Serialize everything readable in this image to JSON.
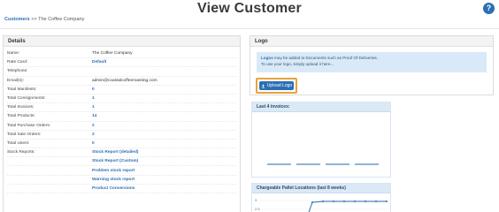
{
  "page": {
    "title": "View Customer"
  },
  "breadcrumb": {
    "root": "Customers",
    "separator": ">>",
    "current": "The Coffee Company"
  },
  "details": {
    "title": "Details",
    "rows": [
      {
        "label": "Name:",
        "value": "The Coffee Company",
        "link": false
      },
      {
        "label": "Rate Card:",
        "value": "Default",
        "link": true
      },
      {
        "label": "Telephone:",
        "value": "",
        "link": false
      },
      {
        "label": "Email(s):",
        "value": "admin@coastalcoffeeroasting.com",
        "link": false
      },
      {
        "label": "Total Manifests:",
        "value": "0",
        "link": true
      },
      {
        "label": "Total Consignments:",
        "value": "1",
        "link": true
      },
      {
        "label": "Total Invoices:",
        "value": "1",
        "link": true
      },
      {
        "label": "Total Products:",
        "value": "14",
        "link": true
      },
      {
        "label": "Total Purchase Orders:",
        "value": "2",
        "link": true
      },
      {
        "label": "Total Sale Orders:",
        "value": "2",
        "link": true
      },
      {
        "label": "Total Users:",
        "value": "0",
        "link": true
      },
      {
        "label": "Stock Reports:",
        "value": "Stock Report (detailed)",
        "link": true
      },
      {
        "label": "",
        "value": "Stock Report (Custom)",
        "link": true
      },
      {
        "label": "",
        "value": "Problem stock report",
        "link": true
      },
      {
        "label": "",
        "value": "Warning stock report",
        "link": true
      },
      {
        "label": "",
        "value": "Product Conversions",
        "link": true
      }
    ]
  },
  "logo": {
    "title": "Logo",
    "info_bold": "Logos",
    "info_line1": " may be added to Documents such as Proof Of Deliveries.",
    "info_line2": "To use your logo, simply upload it here...",
    "upload_label": "Upload Logo",
    "upload_icon": "upload-icon"
  },
  "invoices": {
    "title": "Last 4 invoices:"
  },
  "pallets": {
    "title": "Chargeable Pallet Locations (last 8 weeks)",
    "y_ticks": [
      "3",
      "2.5"
    ]
  },
  "colors": {
    "accent": "#2a6fb5",
    "highlight": "#e8a33a",
    "info_bg": "#d9e9f7"
  }
}
